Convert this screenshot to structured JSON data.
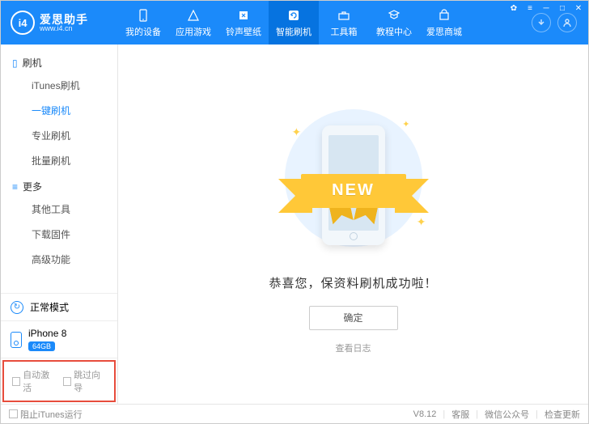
{
  "logo": {
    "glyph": "i4",
    "brand": "爱思助手",
    "url": "www.i4.cn"
  },
  "nav": {
    "items": [
      {
        "label": "我的设备"
      },
      {
        "label": "应用游戏"
      },
      {
        "label": "铃声壁纸"
      },
      {
        "label": "智能刷机"
      },
      {
        "label": "工具箱"
      },
      {
        "label": "教程中心"
      },
      {
        "label": "爱思商城"
      }
    ],
    "activeIndex": 3
  },
  "sidebar": {
    "groups": [
      {
        "title": "刷机",
        "items": [
          {
            "label": "iTunes刷机"
          },
          {
            "label": "一键刷机",
            "active": true
          },
          {
            "label": "专业刷机"
          },
          {
            "label": "批量刷机"
          }
        ]
      },
      {
        "title": "更多",
        "items": [
          {
            "label": "其他工具"
          },
          {
            "label": "下载固件"
          },
          {
            "label": "高级功能"
          }
        ]
      }
    ],
    "mode": "正常模式",
    "device": {
      "name": "iPhone 8",
      "storage": "64GB"
    },
    "checks": {
      "autoActivate": "自动激活",
      "skipGuide": "跳过向导"
    }
  },
  "main": {
    "ribbon": "NEW",
    "success": "恭喜您，保资料刷机成功啦！",
    "okButton": "确定",
    "logLink": "查看日志"
  },
  "footer": {
    "blockItunes": "阻止iTunes运行",
    "version": "V8.12",
    "support": "客服",
    "wechat": "微信公众号",
    "update": "检查更新"
  }
}
